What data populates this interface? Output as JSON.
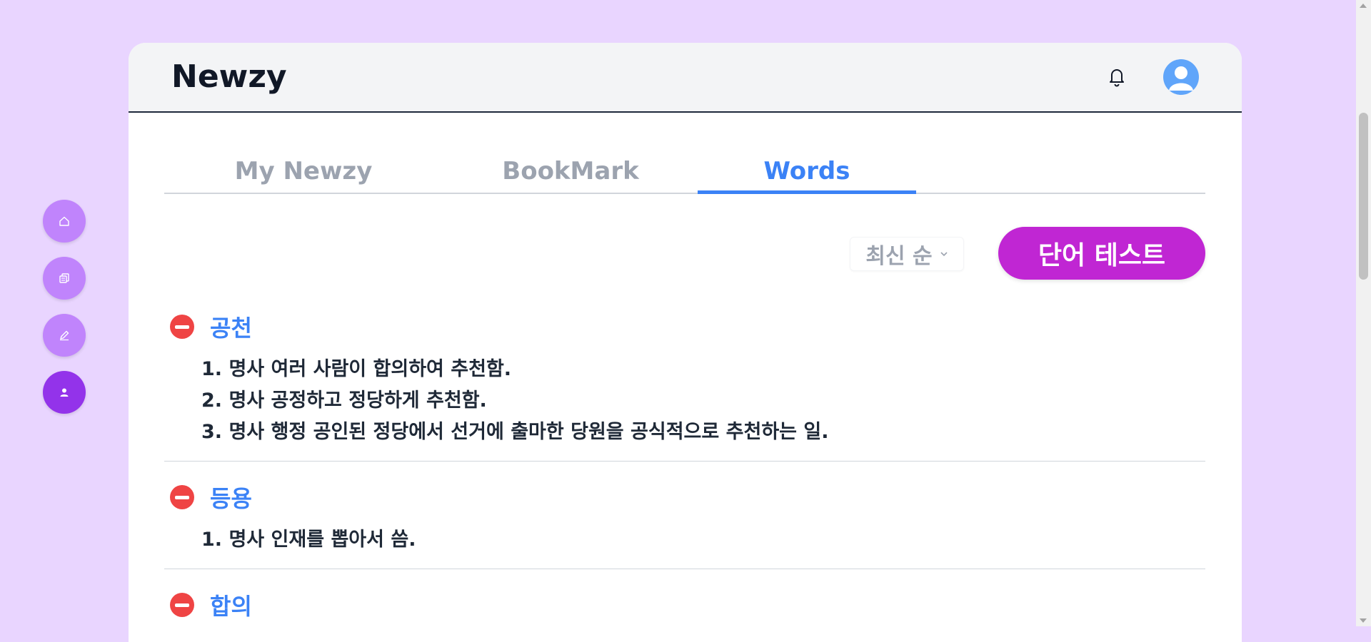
{
  "app": {
    "logo": "Newzy"
  },
  "colors": {
    "background": "#e9d5ff",
    "accent": "#3b82f6",
    "primary_button": "#c026d3",
    "remove": "#ef4444",
    "nav": "#c084fc",
    "nav_active": "#9333ea"
  },
  "sidenav": {
    "items": [
      {
        "name": "home",
        "icon": "home-icon"
      },
      {
        "name": "copy",
        "icon": "copy-icon"
      },
      {
        "name": "edit",
        "icon": "pencil-icon"
      },
      {
        "name": "profile",
        "icon": "user-icon",
        "active": true
      }
    ]
  },
  "header": {
    "notification_icon": "bell-icon",
    "avatar_icon": "user-avatar-icon"
  },
  "tabs": [
    {
      "label": "My Newzy",
      "active": false
    },
    {
      "label": "BookMark",
      "active": false
    },
    {
      "label": "Words",
      "active": true
    }
  ],
  "controls": {
    "sort_label": "최신 순",
    "test_button_label": "단어 테스트"
  },
  "words": [
    {
      "word": "공천",
      "meanings": [
        "1. 명사 여러 사람이 합의하여 추천함.",
        "2. 명사 공정하고 정당하게 추천함.",
        "3. 명사 행정 공인된 정당에서 선거에 출마한 당원을 공식적으로 추천하는 일."
      ]
    },
    {
      "word": "등용",
      "meanings": [
        "1. 명사 인재를 뽑아서 씀."
      ]
    },
    {
      "word": "합의",
      "meanings": []
    }
  ]
}
